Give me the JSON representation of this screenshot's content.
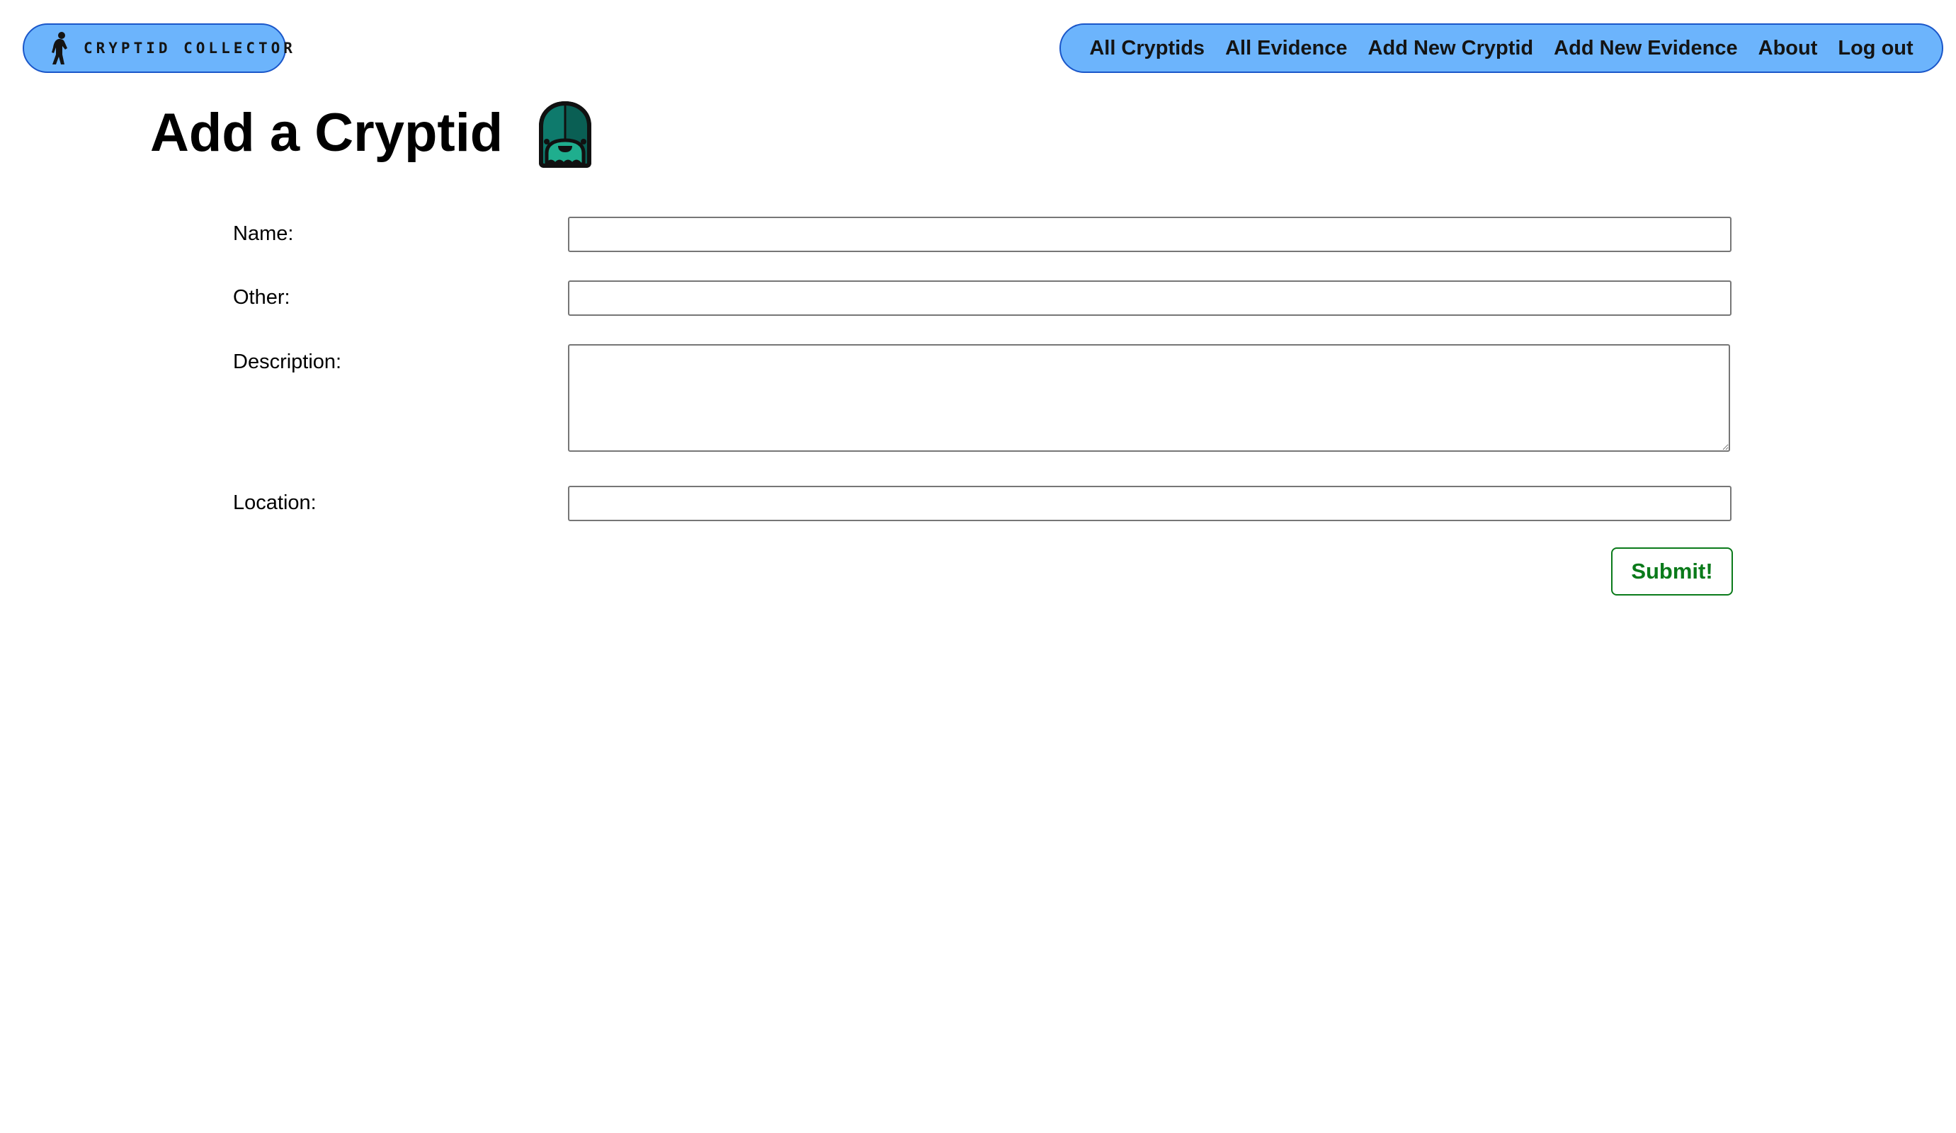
{
  "header": {
    "logo_text": "CRYPTID COLLECTOR",
    "nav": [
      {
        "label": "All Cryptids"
      },
      {
        "label": "All Evidence"
      },
      {
        "label": "Add New Cryptid"
      },
      {
        "label": "Add New Evidence"
      },
      {
        "label": "About"
      },
      {
        "label": "Log out"
      }
    ]
  },
  "page": {
    "title": "Add a Cryptid",
    "title_icon": "cryptid-creature-icon"
  },
  "form": {
    "fields": [
      {
        "label": "Name:",
        "value": "",
        "placeholder": ""
      },
      {
        "label": "Other:",
        "value": "",
        "placeholder": ""
      },
      {
        "label": "Description:",
        "value": "",
        "placeholder": ""
      },
      {
        "label": "Location:",
        "value": "",
        "placeholder": ""
      }
    ],
    "submit_label": "Submit!"
  },
  "colors": {
    "nav_background": "#6cb4fc",
    "nav_border": "#1a56c9",
    "submit_accent": "#0a7a1a",
    "icon_teal": "#0e7a6c"
  }
}
